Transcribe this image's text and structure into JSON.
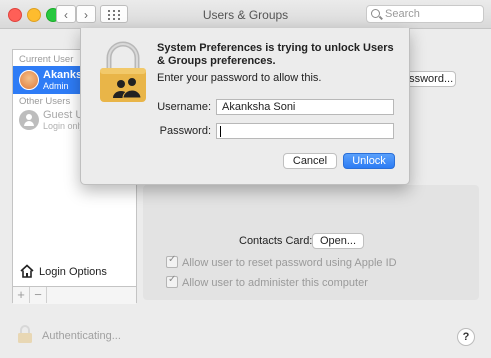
{
  "window": {
    "title": "Users & Groups"
  },
  "toolbar": {
    "back_glyph": "‹",
    "forward_glyph": "›",
    "search_placeholder": "Search"
  },
  "sidebar": {
    "current_user_label": "Current User",
    "current_user": {
      "name": "Akanksha...",
      "role": "Admin"
    },
    "other_users_label": "Other Users",
    "other_users": [
      {
        "name": "Guest Us",
        "role": "Login only"
      }
    ],
    "login_options_label": "Login Options",
    "add_glyph": "+",
    "remove_glyph": "−"
  },
  "main": {
    "password_button_label": "assword...",
    "contacts_card_label": "Contacts Card:",
    "open_button_label": "Open...",
    "checkbox_reset_password": "Allow user to reset password using Apple ID",
    "checkbox_administer": "Allow user to administer this computer"
  },
  "footer": {
    "status": "Authenticating...",
    "help_glyph": "?"
  },
  "dialog": {
    "title": "System Preferences is trying to unlock Users & Groups preferences.",
    "message": "Enter your password to allow this.",
    "username_label": "Username:",
    "username_value": "Akanksha Soni",
    "password_label": "Password:",
    "password_value": "",
    "cancel_label": "Cancel",
    "unlock_label": "Unlock"
  },
  "colors": {
    "accent": "#2e7cf6",
    "lock_gold": "#e9b548",
    "close": "#ff5f57",
    "minimize": "#febc2e",
    "zoom": "#28c840"
  }
}
